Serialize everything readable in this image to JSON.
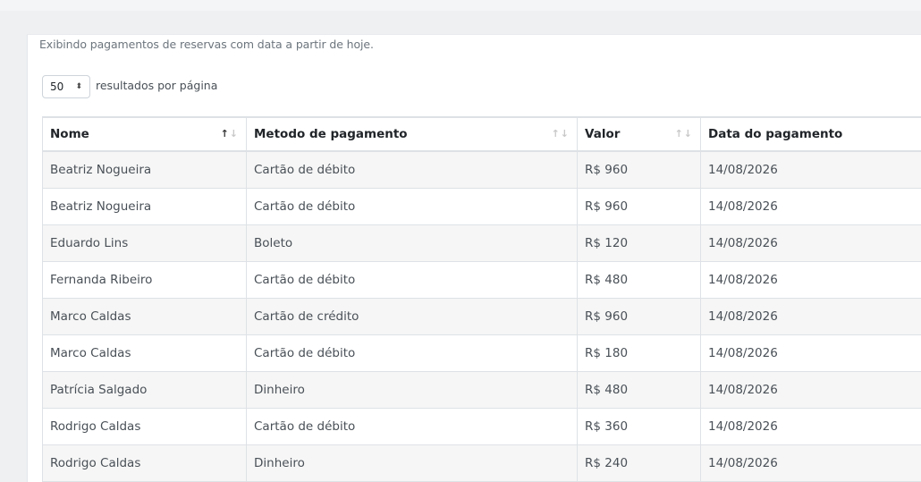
{
  "notice": "Exibindo pagamentos de reservas com data a partir de hoje.",
  "page_length": {
    "value": "50",
    "label": "resultados por página"
  },
  "table": {
    "columns": [
      {
        "label": "Nome",
        "sort": "asc"
      },
      {
        "label": "Metodo de pagamento",
        "sort": "none"
      },
      {
        "label": "Valor",
        "sort": "none"
      },
      {
        "label": "Data do pagamento",
        "sort": "none"
      }
    ],
    "rows": [
      [
        "Beatriz Nogueira",
        "Cartão de débito",
        "R$ 960",
        "14/08/2026"
      ],
      [
        "Beatriz Nogueira",
        "Cartão de débito",
        "R$ 960",
        "14/08/2026"
      ],
      [
        "Eduardo Lins",
        "Boleto",
        "R$ 120",
        "14/08/2026"
      ],
      [
        "Fernanda Ribeiro",
        "Cartão de débito",
        "R$ 480",
        "14/08/2026"
      ],
      [
        "Marco Caldas",
        "Cartão de crédito",
        "R$ 960",
        "14/08/2026"
      ],
      [
        "Marco Caldas",
        "Cartão de débito",
        "R$ 180",
        "14/08/2026"
      ],
      [
        "Patrícia Salgado",
        "Dinheiro",
        "R$ 480",
        "14/08/2026"
      ],
      [
        "Rodrigo Caldas",
        "Cartão de débito",
        "R$ 360",
        "14/08/2026"
      ],
      [
        "Rodrigo Caldas",
        "Dinheiro",
        "R$ 240",
        "14/08/2026"
      ]
    ]
  },
  "icons": {
    "sort_up": "↑",
    "sort_down": "↓",
    "select_caret": "⬍"
  }
}
